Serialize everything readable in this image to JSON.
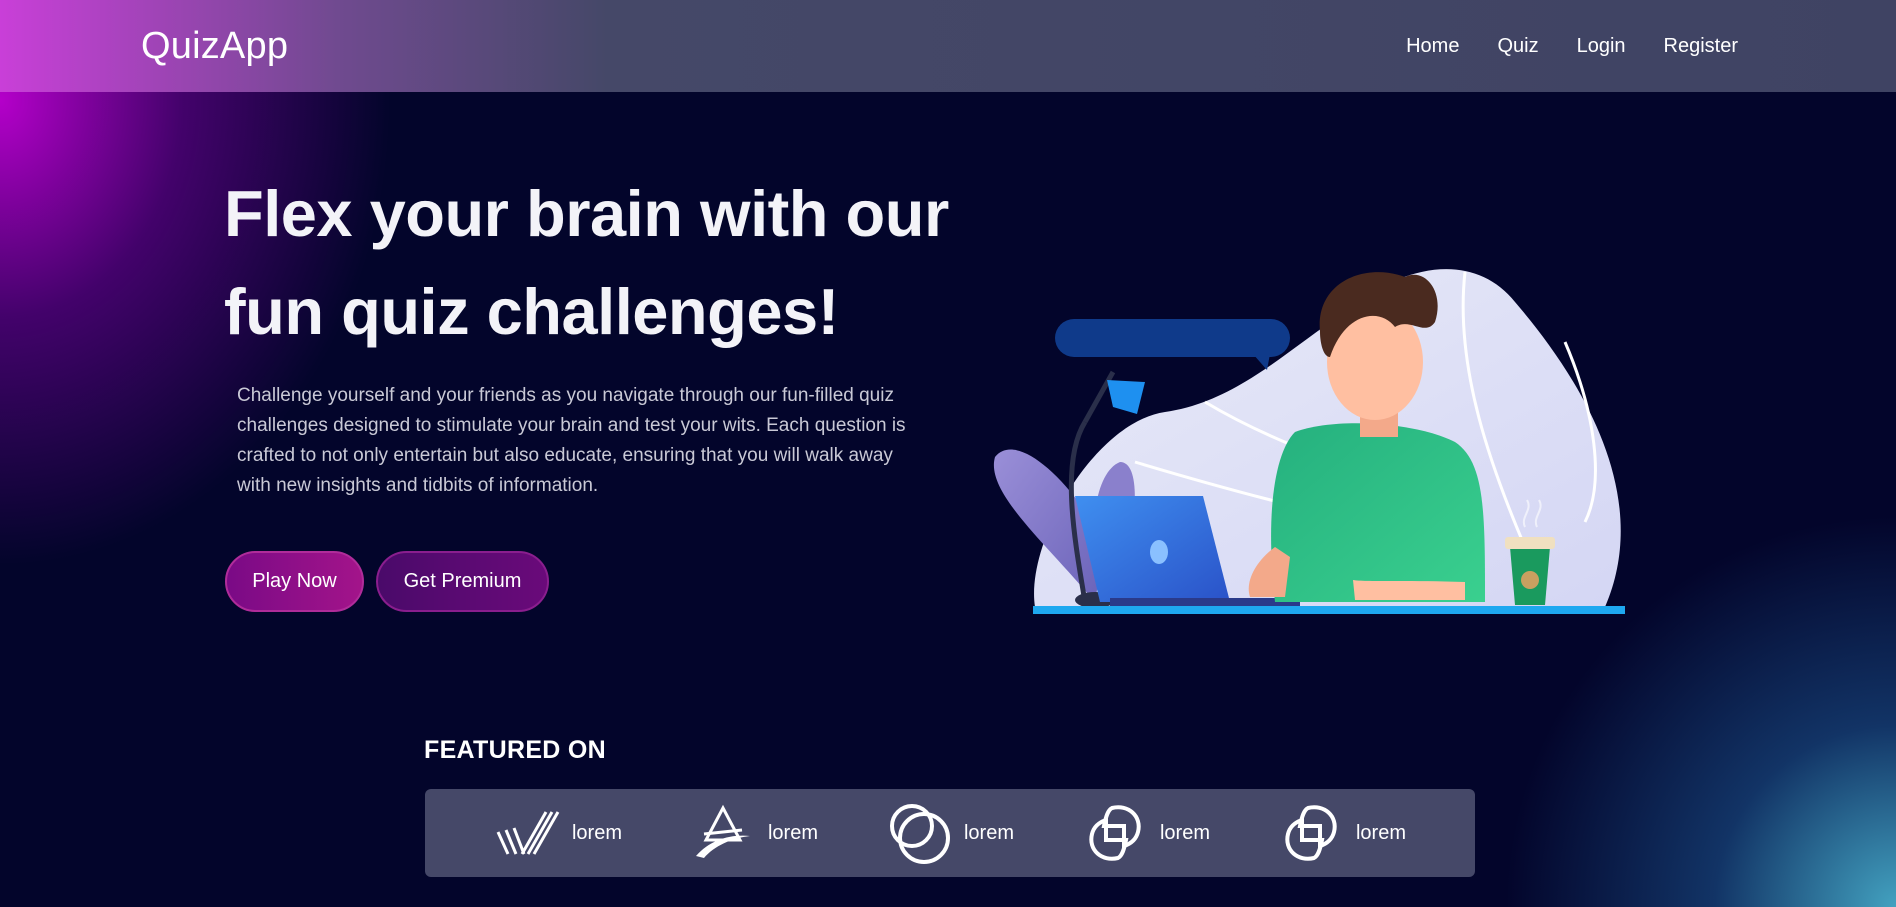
{
  "navbar": {
    "brand": "QuizApp",
    "links": [
      "Home",
      "Quiz",
      "Login",
      "Register"
    ]
  },
  "hero": {
    "title": "Flex your brain with our fun quiz challenges!",
    "description": "Challenge yourself and your friends as you navigate through our fun-filled quiz challenges designed to stimulate your brain and test your wits. Each question is crafted to not only entertain but also educate, ensuring that you will walk away with new insights and tidbits of information.",
    "primary_button": "Play Now",
    "secondary_button": "Get Premium"
  },
  "featured": {
    "title": "FEATURED ON",
    "logos": [
      {
        "icon": "stripes-logo-icon",
        "text": "lorem"
      },
      {
        "icon": "triangle-swoosh-logo-icon",
        "text": "lorem"
      },
      {
        "icon": "overlapping-circles-logo-icon",
        "text": "lorem"
      },
      {
        "icon": "linked-squares-logo-icon",
        "text": "lorem"
      },
      {
        "icon": "linked-squares-logo-icon",
        "text": "lorem"
      }
    ]
  },
  "colors": {
    "background": "#03052b",
    "navbar": "#3f4363",
    "accent_magenta": "#a3148a",
    "featured_bar": "#454868"
  }
}
